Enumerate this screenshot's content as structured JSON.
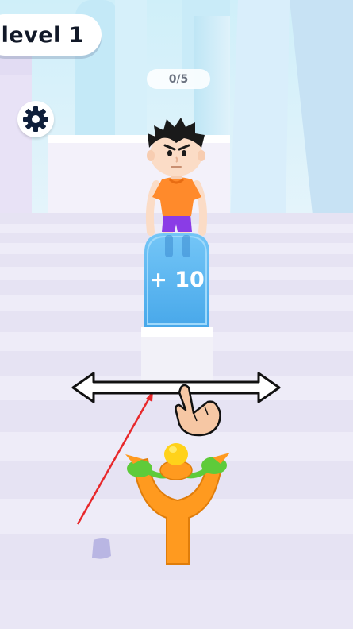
{
  "hud": {
    "level_label": "level 1",
    "progress_counter": "0/5"
  },
  "settings": {
    "icon": "gear-icon"
  },
  "gate": {
    "bonus_label": "+ 10",
    "color": "#5ab4f0"
  },
  "tutorial": {
    "hint_icon": "pointing-hand-icon",
    "direction": "swipe-left-right"
  },
  "character": {
    "shirt_color": "#ff8a2b",
    "shorts_color": "#8a3ce6",
    "hair_color": "#1a1a1a"
  },
  "slingshot": {
    "color": "#ff9a1f",
    "grip_color": "#5ecb3a",
    "ammo_color": "#ffd21a"
  },
  "colors": {
    "aim_line": "#e8282b",
    "floor": "#e8e5f4"
  }
}
